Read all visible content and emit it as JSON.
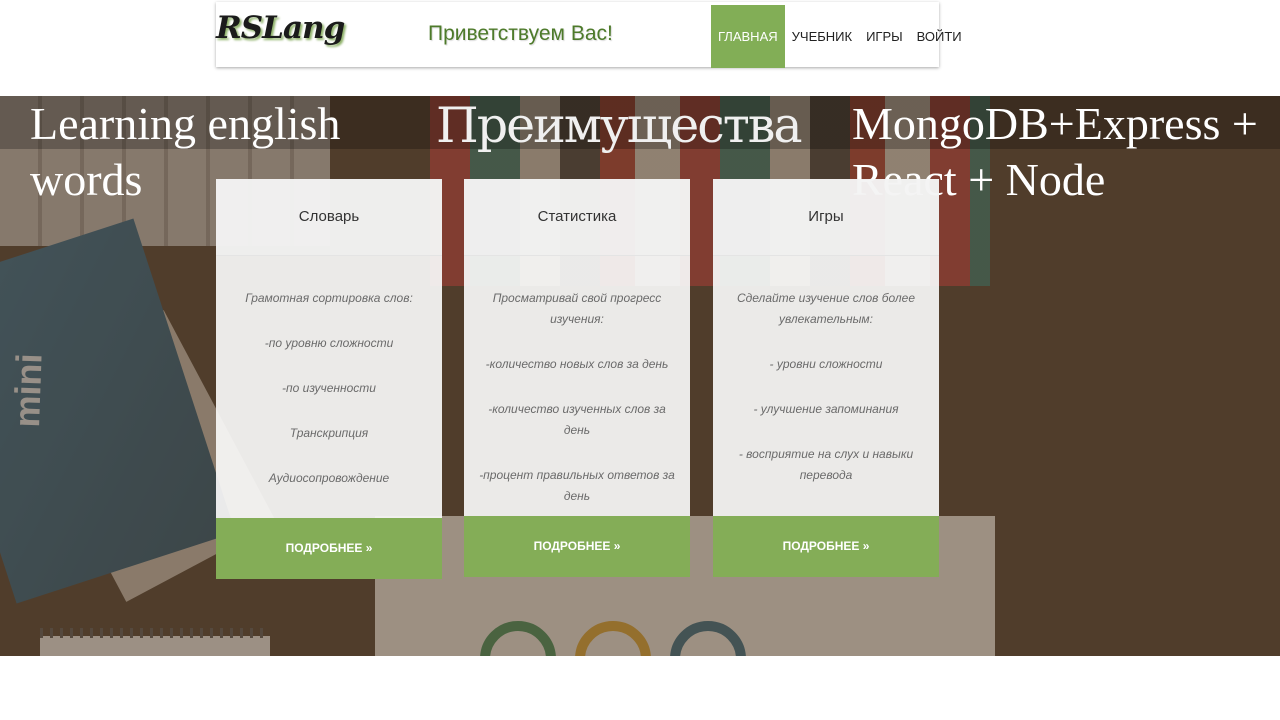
{
  "header": {
    "logo": "RSLang",
    "greeting": "Приветствуем Вас!",
    "nav": [
      {
        "label": "ГЛАВНАЯ",
        "active": true
      },
      {
        "label": "УЧЕБНИК"
      },
      {
        "label": "ИГРЫ"
      },
      {
        "label": "ВОЙТИ"
      }
    ]
  },
  "hero": {
    "left_text": "Learning english words",
    "center_text": "Преимущества",
    "right_text": "MongoDB+Express + React + Node",
    "book_text": "mini"
  },
  "cards": [
    {
      "title": "Словарь",
      "lines": [
        "Грамотная сортировка слов:",
        "-по уровню сложности",
        "-по изученности",
        "Транскрипция",
        "Аудиосопровождение"
      ],
      "button": "ПОДРОБНЕЕ »"
    },
    {
      "title": "Статистика",
      "lines": [
        "Просматривай свой прогресс изучения:",
        "-количество новых слов за день",
        "-количество изученных слов за день",
        "-процент правильных ответов за день"
      ],
      "button": "ПОДРОБНЕЕ »"
    },
    {
      "title": "Игры",
      "lines": [
        "Сделайте изучение слов более увлекательным:",
        "- уровни сложности",
        "- улучшение запоминания",
        "- восприятие на слух и навыки перевода"
      ],
      "button": "ПОДРОБНЕЕ »"
    }
  ],
  "colors": {
    "accent": "#84ad57",
    "greeting": "#4d7a2a"
  }
}
